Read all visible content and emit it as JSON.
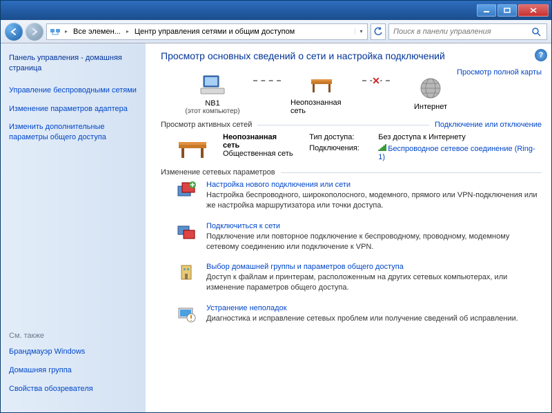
{
  "breadcrumb": {
    "seg1": "Все элемен...",
    "seg2": "Центр управления сетями и общим доступом"
  },
  "search": {
    "placeholder": "Поиск в панели управления"
  },
  "sidebar": {
    "home": "Панель управления - домашняя страница",
    "links": [
      "Управление беспроводными сетями",
      "Изменение параметров адаптера",
      "Изменить дополнительные параметры общего доступа"
    ],
    "also_hdr": "См. также",
    "also": [
      "Брандмауэр Windows",
      "Домашняя группа",
      "Свойства обозревателя"
    ]
  },
  "page_title": "Просмотр основных сведений о сети и настройка подключений",
  "map": {
    "full_map": "Просмотр полной карты",
    "node1": {
      "name": "NB1",
      "sub": "(этот компьютер)"
    },
    "node2": {
      "name": "Неопознанная сеть"
    },
    "node3": {
      "name": "Интернет"
    }
  },
  "active_hdr": "Просмотр активных сетей",
  "active_link": "Подключение или отключение",
  "active": {
    "name": "Неопознанная сеть",
    "type": "Общественная сеть",
    "access_lbl": "Тип доступа:",
    "access_val": "Без доступа к Интернету",
    "conn_lbl": "Подключения:",
    "conn_val": "Беспроводное сетевое соединение (Ring-1)"
  },
  "change_hdr": "Изменение сетевых параметров",
  "tasks": [
    {
      "title": "Настройка нового подключения или сети",
      "desc": "Настройка беспроводного, широкополосного, модемного, прямого или VPN-подключения или же настройка маршрутизатора или точки доступа."
    },
    {
      "title": "Подключиться к сети",
      "desc": "Подключение или повторное подключение к беспроводному, проводному, модемному сетевому соединению или подключение к VPN."
    },
    {
      "title": "Выбор домашней группы и параметров общего доступа",
      "desc": "Доступ к файлам и принтерам, расположенным на других сетевых компьютерах, или изменение параметров общего доступа."
    },
    {
      "title": "Устранение неполадок",
      "desc": "Диагностика и исправление сетевых проблем или получение сведений об исправлении."
    }
  ]
}
